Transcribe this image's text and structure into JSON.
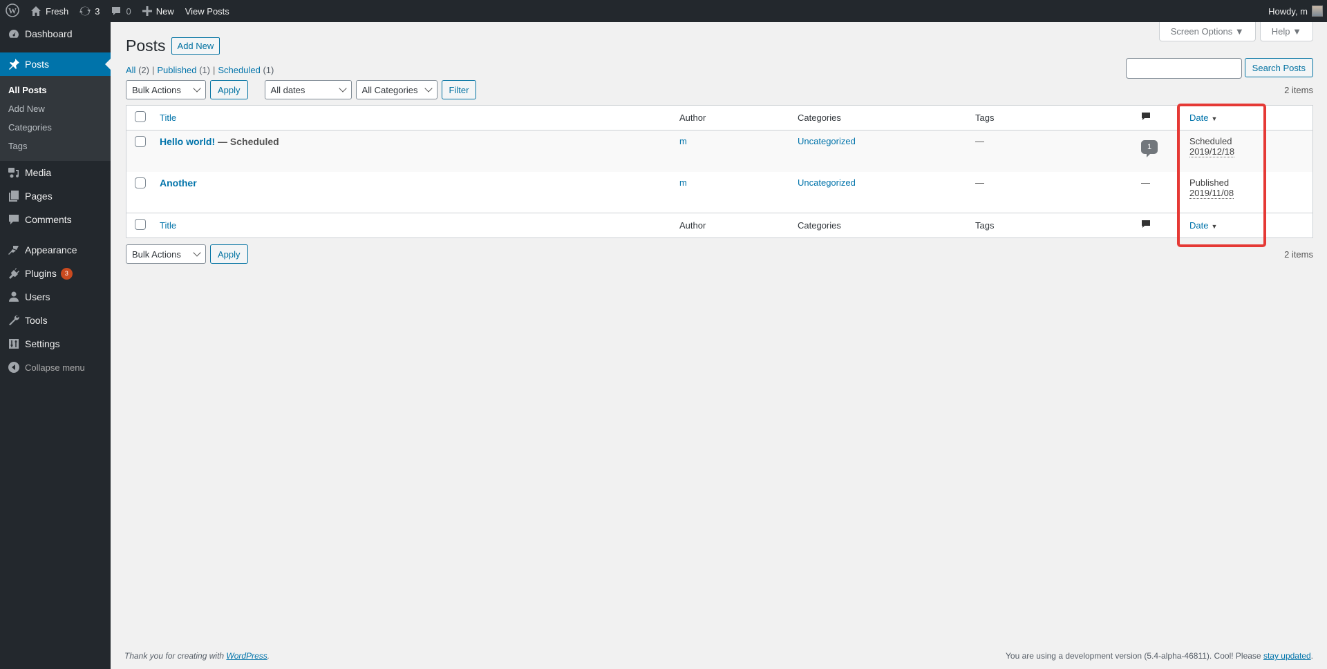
{
  "adminbar": {
    "site_name": "Fresh",
    "updates_count": "3",
    "comments_count": "0",
    "new_label": "New",
    "view_posts_label": "View Posts",
    "howdy": "Howdy, m"
  },
  "sidebar": {
    "items": [
      {
        "label": "Dashboard",
        "icon": "dashboard-icon"
      },
      {
        "label": "Posts",
        "icon": "pin-icon",
        "active": true
      },
      {
        "label": "Media",
        "icon": "media-icon"
      },
      {
        "label": "Pages",
        "icon": "pages-icon"
      },
      {
        "label": "Comments",
        "icon": "comments-icon"
      },
      {
        "label": "Appearance",
        "icon": "brush-icon"
      },
      {
        "label": "Plugins",
        "icon": "plugin-icon",
        "badge": "3"
      },
      {
        "label": "Users",
        "icon": "user-icon"
      },
      {
        "label": "Tools",
        "icon": "wrench-icon"
      },
      {
        "label": "Settings",
        "icon": "settings-icon"
      }
    ],
    "submenu": [
      "All Posts",
      "Add New",
      "Categories",
      "Tags"
    ],
    "collapse_label": "Collapse menu"
  },
  "screen_meta": {
    "screen_options": "Screen Options ▼",
    "help": "Help ▼"
  },
  "page": {
    "title": "Posts",
    "add_new": "Add New",
    "views": [
      {
        "label": "All",
        "count": "(2)"
      },
      {
        "label": "Published",
        "count": "(1)"
      },
      {
        "label": "Scheduled",
        "count": "(1)"
      }
    ],
    "search_placeholder": "",
    "search_button": "Search Posts",
    "bulk_actions": "Bulk Actions",
    "apply": "Apply",
    "dates_filter": "All dates",
    "categories_filter": "All Categories",
    "filter": "Filter",
    "items_count": "2 items"
  },
  "table": {
    "columns": {
      "title": "Title",
      "author": "Author",
      "categories": "Categories",
      "tags": "Tags",
      "date": "Date"
    },
    "rows": [
      {
        "title": "Hello world!",
        "state": " — Scheduled",
        "author": "m",
        "category": "Uncategorized",
        "tags": "—",
        "comments": "1",
        "date_status": "Scheduled",
        "date": "2019/12/18"
      },
      {
        "title": "Another",
        "state": "",
        "author": "m",
        "category": "Uncategorized",
        "tags": "—",
        "comments": "—",
        "date_status": "Published",
        "date": "2019/11/08"
      }
    ]
  },
  "footer": {
    "left_text": "Thank you for creating with ",
    "left_link": "WordPress",
    "right_text": "You are using a development version (5.4-alpha-46811). Cool! Please ",
    "right_link": "stay updated"
  },
  "colors": {
    "accent": "#0073aa",
    "highlight": "#e53935",
    "badge": "#ca4a1f"
  }
}
